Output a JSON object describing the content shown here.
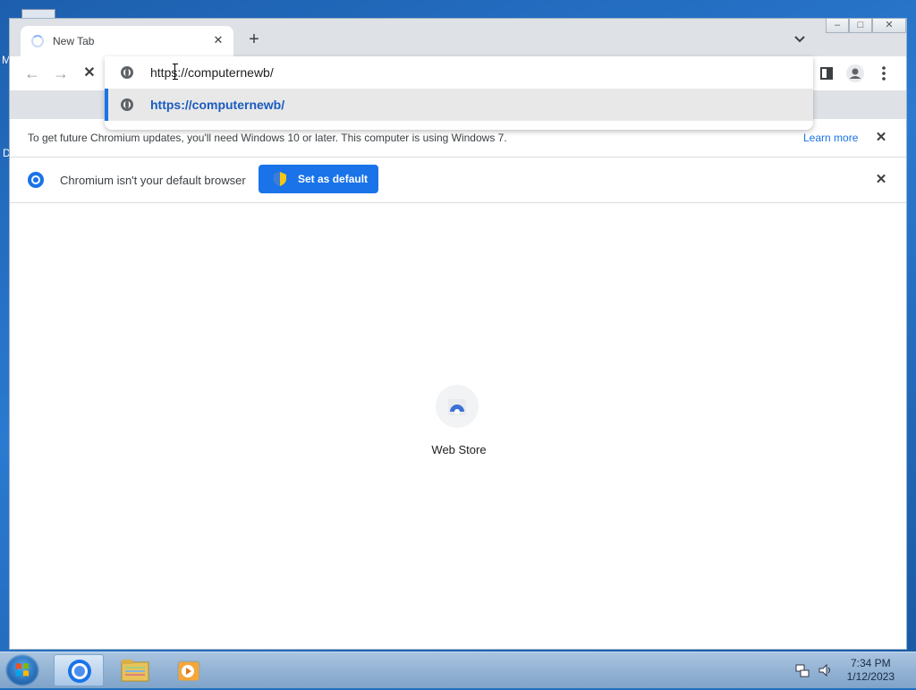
{
  "desktop": {
    "left_fragments": [
      "M",
      "D"
    ]
  },
  "browser": {
    "tab": {
      "title": "New Tab",
      "close_icon": "✕"
    },
    "new_tab_icon": "+",
    "tab_search_icon": "⌄",
    "window_controls": {
      "minimize": "–",
      "maximize": "□",
      "close": "✕"
    },
    "nav": {
      "back": "←",
      "forward": "→",
      "stop": "✕"
    },
    "omnibox": {
      "text": "https://computernewb/",
      "suggestion": "https://computernewb/"
    }
  },
  "infobar_update": {
    "message": "To get future Chromium updates, you'll need Windows 10 or later. This computer is using Windows 7.",
    "link": "Learn more",
    "close": "✕"
  },
  "infobar_default": {
    "message": "Chromium isn't your default browser",
    "button": "Set as default",
    "close": "✕"
  },
  "ntp": {
    "shortcut_label": "Web Store"
  },
  "taskbar": {
    "time": "7:34 PM",
    "date": "1/12/2023"
  },
  "colors": {
    "accent": "#1a73e8",
    "suggestion": "#1a5bbf"
  }
}
